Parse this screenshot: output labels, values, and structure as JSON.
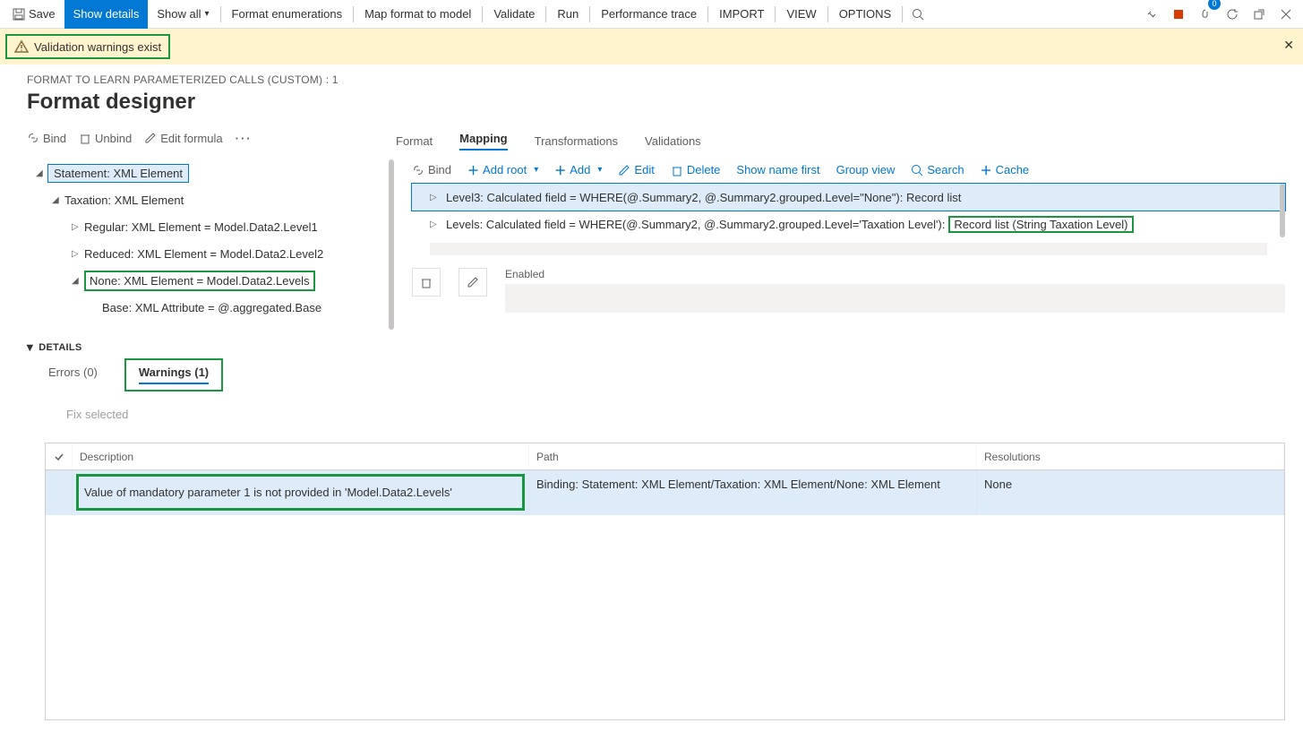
{
  "toolbar": {
    "save": "Save",
    "show_details": "Show details",
    "show_all": "Show all",
    "format_enum": "Format enumerations",
    "map_format": "Map format to model",
    "validate": "Validate",
    "run": "Run",
    "perf": "Performance trace",
    "import": "IMPORT",
    "view": "VIEW",
    "options": "OPTIONS",
    "badge_count": "0"
  },
  "banner": {
    "text": "Validation warnings exist"
  },
  "header": {
    "breadcrumb": "FORMAT TO LEARN PARAMETERIZED CALLS (CUSTOM) : 1",
    "title": "Format designer"
  },
  "left_tb": {
    "bind": "Bind",
    "unbind": "Unbind",
    "edit_formula": "Edit formula"
  },
  "tree": {
    "n0": "Statement: XML Element",
    "n1": "Taxation: XML Element",
    "n2": "Regular: XML Element = Model.Data2.Level1",
    "n3": "Reduced: XML Element = Model.Data2.Level2",
    "n4": "None: XML Element = Model.Data2.Levels",
    "n5": "Base: XML Attribute = @.aggregated.Base"
  },
  "details": {
    "header": "DETAILS",
    "errors": "Errors (0)",
    "warnings": "Warnings (1)",
    "fix_selected": "Fix selected"
  },
  "rtabs": {
    "format": "Format",
    "mapping": "Mapping",
    "transformations": "Transformations",
    "validations": "Validations"
  },
  "rtoolbar": {
    "bind": "Bind",
    "add_root": "Add root",
    "add": "Add",
    "edit": "Edit",
    "delete": "Delete",
    "show_name_first": "Show name first",
    "group_view": "Group view",
    "search": "Search",
    "cache": "Cache"
  },
  "records": {
    "r1": "Level3: Calculated field = WHERE(@.Summary2, @.Summary2.grouped.Level=\"None\"): Record list",
    "r2_prefix": "Levels: Calculated field = WHERE(@.Summary2, @.Summary2.grouped.Level='Taxation Level'): ",
    "r2_highlight": "Record list (String Taxation Level)"
  },
  "enabled": {
    "label": "Enabled"
  },
  "wtable": {
    "h_desc": "Description",
    "h_path": "Path",
    "h_res": "Resolutions",
    "row1": {
      "desc": "Value of mandatory parameter 1 is not provided in 'Model.Data2.Levels'",
      "path": "Binding: Statement: XML Element/Taxation: XML Element/None: XML Element",
      "res": "None"
    }
  }
}
